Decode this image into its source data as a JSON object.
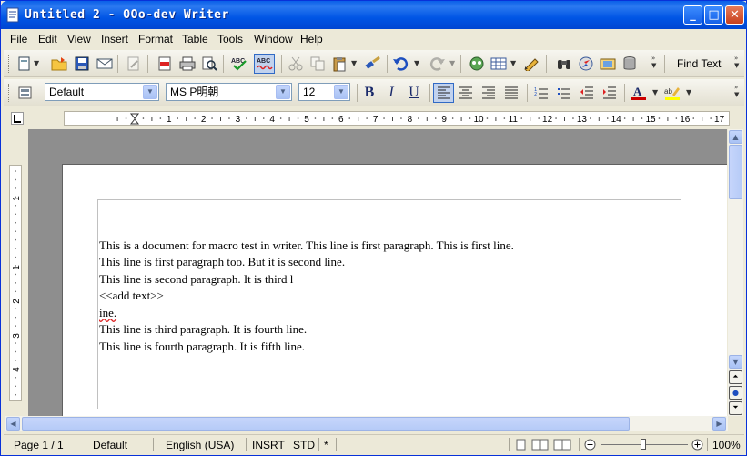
{
  "window": {
    "title": "Untitled 2 - OOo-dev Writer",
    "minimize": "_",
    "maximize": "□",
    "close": "✕"
  },
  "menu": [
    "File",
    "Edit",
    "View",
    "Insert",
    "Format",
    "Table",
    "Tools",
    "Window",
    "Help"
  ],
  "formatting": {
    "style": "Default",
    "font": "MS P明朝",
    "size": "12",
    "bold": "B",
    "italic": "I",
    "underline": "U"
  },
  "find_toolbar": {
    "label": "Find Text"
  },
  "ruler": {
    "h_labels": [
      "1",
      "2",
      "3",
      "4",
      "5",
      "6",
      "7",
      "8",
      "9",
      "10",
      "11",
      "12",
      "13",
      "14",
      "15",
      "16",
      "17"
    ],
    "v_labels": [
      "1",
      "1",
      "2",
      "3",
      "4"
    ]
  },
  "document": {
    "lines": [
      "This is a document for macro test in writer.   This line is first paragraph. This is first line.",
      "This line is first paragraph too. But it is second line.",
      "This line is second paragraph. It is third l",
      "<<add text>>",
      "ine.",
      "This line is third  paragraph. It is fourth line.",
      "This line is fourth  paragraph. It is fifth line."
    ]
  },
  "statusbar": {
    "page": "Page 1 / 1",
    "style": "Default",
    "language": "English (USA)",
    "insert_mode": "INSRT",
    "selection_mode": "STD",
    "modified": "*",
    "zoom": "100%"
  },
  "colors": {
    "title_bar": "#0055e5",
    "workspace": "#8e8e8e",
    "font_color_red": "#cc0000",
    "highlight_yellow": "#ffff00"
  }
}
